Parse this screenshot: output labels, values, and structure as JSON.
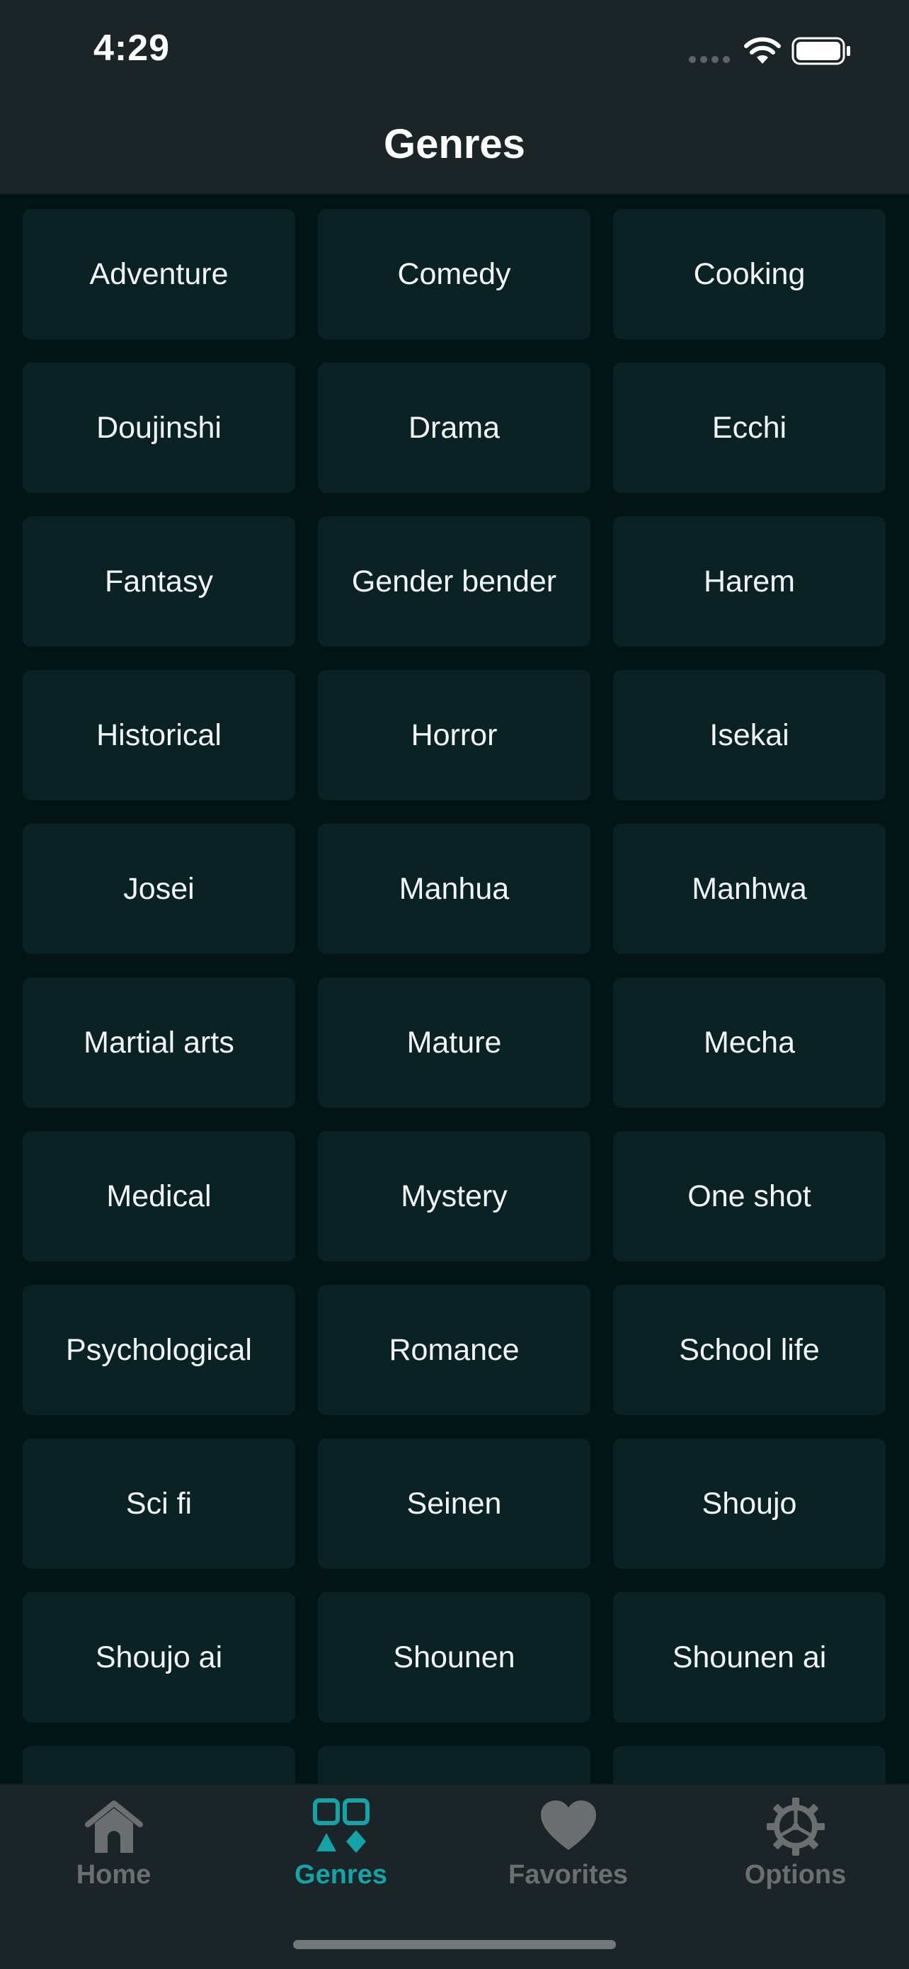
{
  "status_bar": {
    "time": "4:29"
  },
  "header": {
    "title": "Genres"
  },
  "genres": [
    "Adventure",
    "Comedy",
    "Cooking",
    "Doujinshi",
    "Drama",
    "Ecchi",
    "Fantasy",
    "Gender bender",
    "Harem",
    "Historical",
    "Horror",
    "Isekai",
    "Josei",
    "Manhua",
    "Manhwa",
    "Martial arts",
    "Mature",
    "Mecha",
    "Medical",
    "Mystery",
    "One shot",
    "Psychological",
    "Romance",
    "School life",
    "Sci fi",
    "Seinen",
    "Shoujo",
    "Shoujo ai",
    "Shounen",
    "Shounen ai",
    "",
    "",
    ""
  ],
  "tab_bar": {
    "tabs": [
      {
        "label": "Home",
        "icon": "home-icon",
        "active": false
      },
      {
        "label": "Genres",
        "icon": "grid-shapes-icon",
        "active": true
      },
      {
        "label": "Favorites",
        "icon": "heart-icon",
        "active": false
      },
      {
        "label": "Options",
        "icon": "gear-icon",
        "active": false
      }
    ]
  },
  "colors": {
    "background": "#031415",
    "bar_background": "#1b2426",
    "tile_background": "#0a2224",
    "accent": "#14a3a6",
    "inactive": "#6b6f70"
  }
}
